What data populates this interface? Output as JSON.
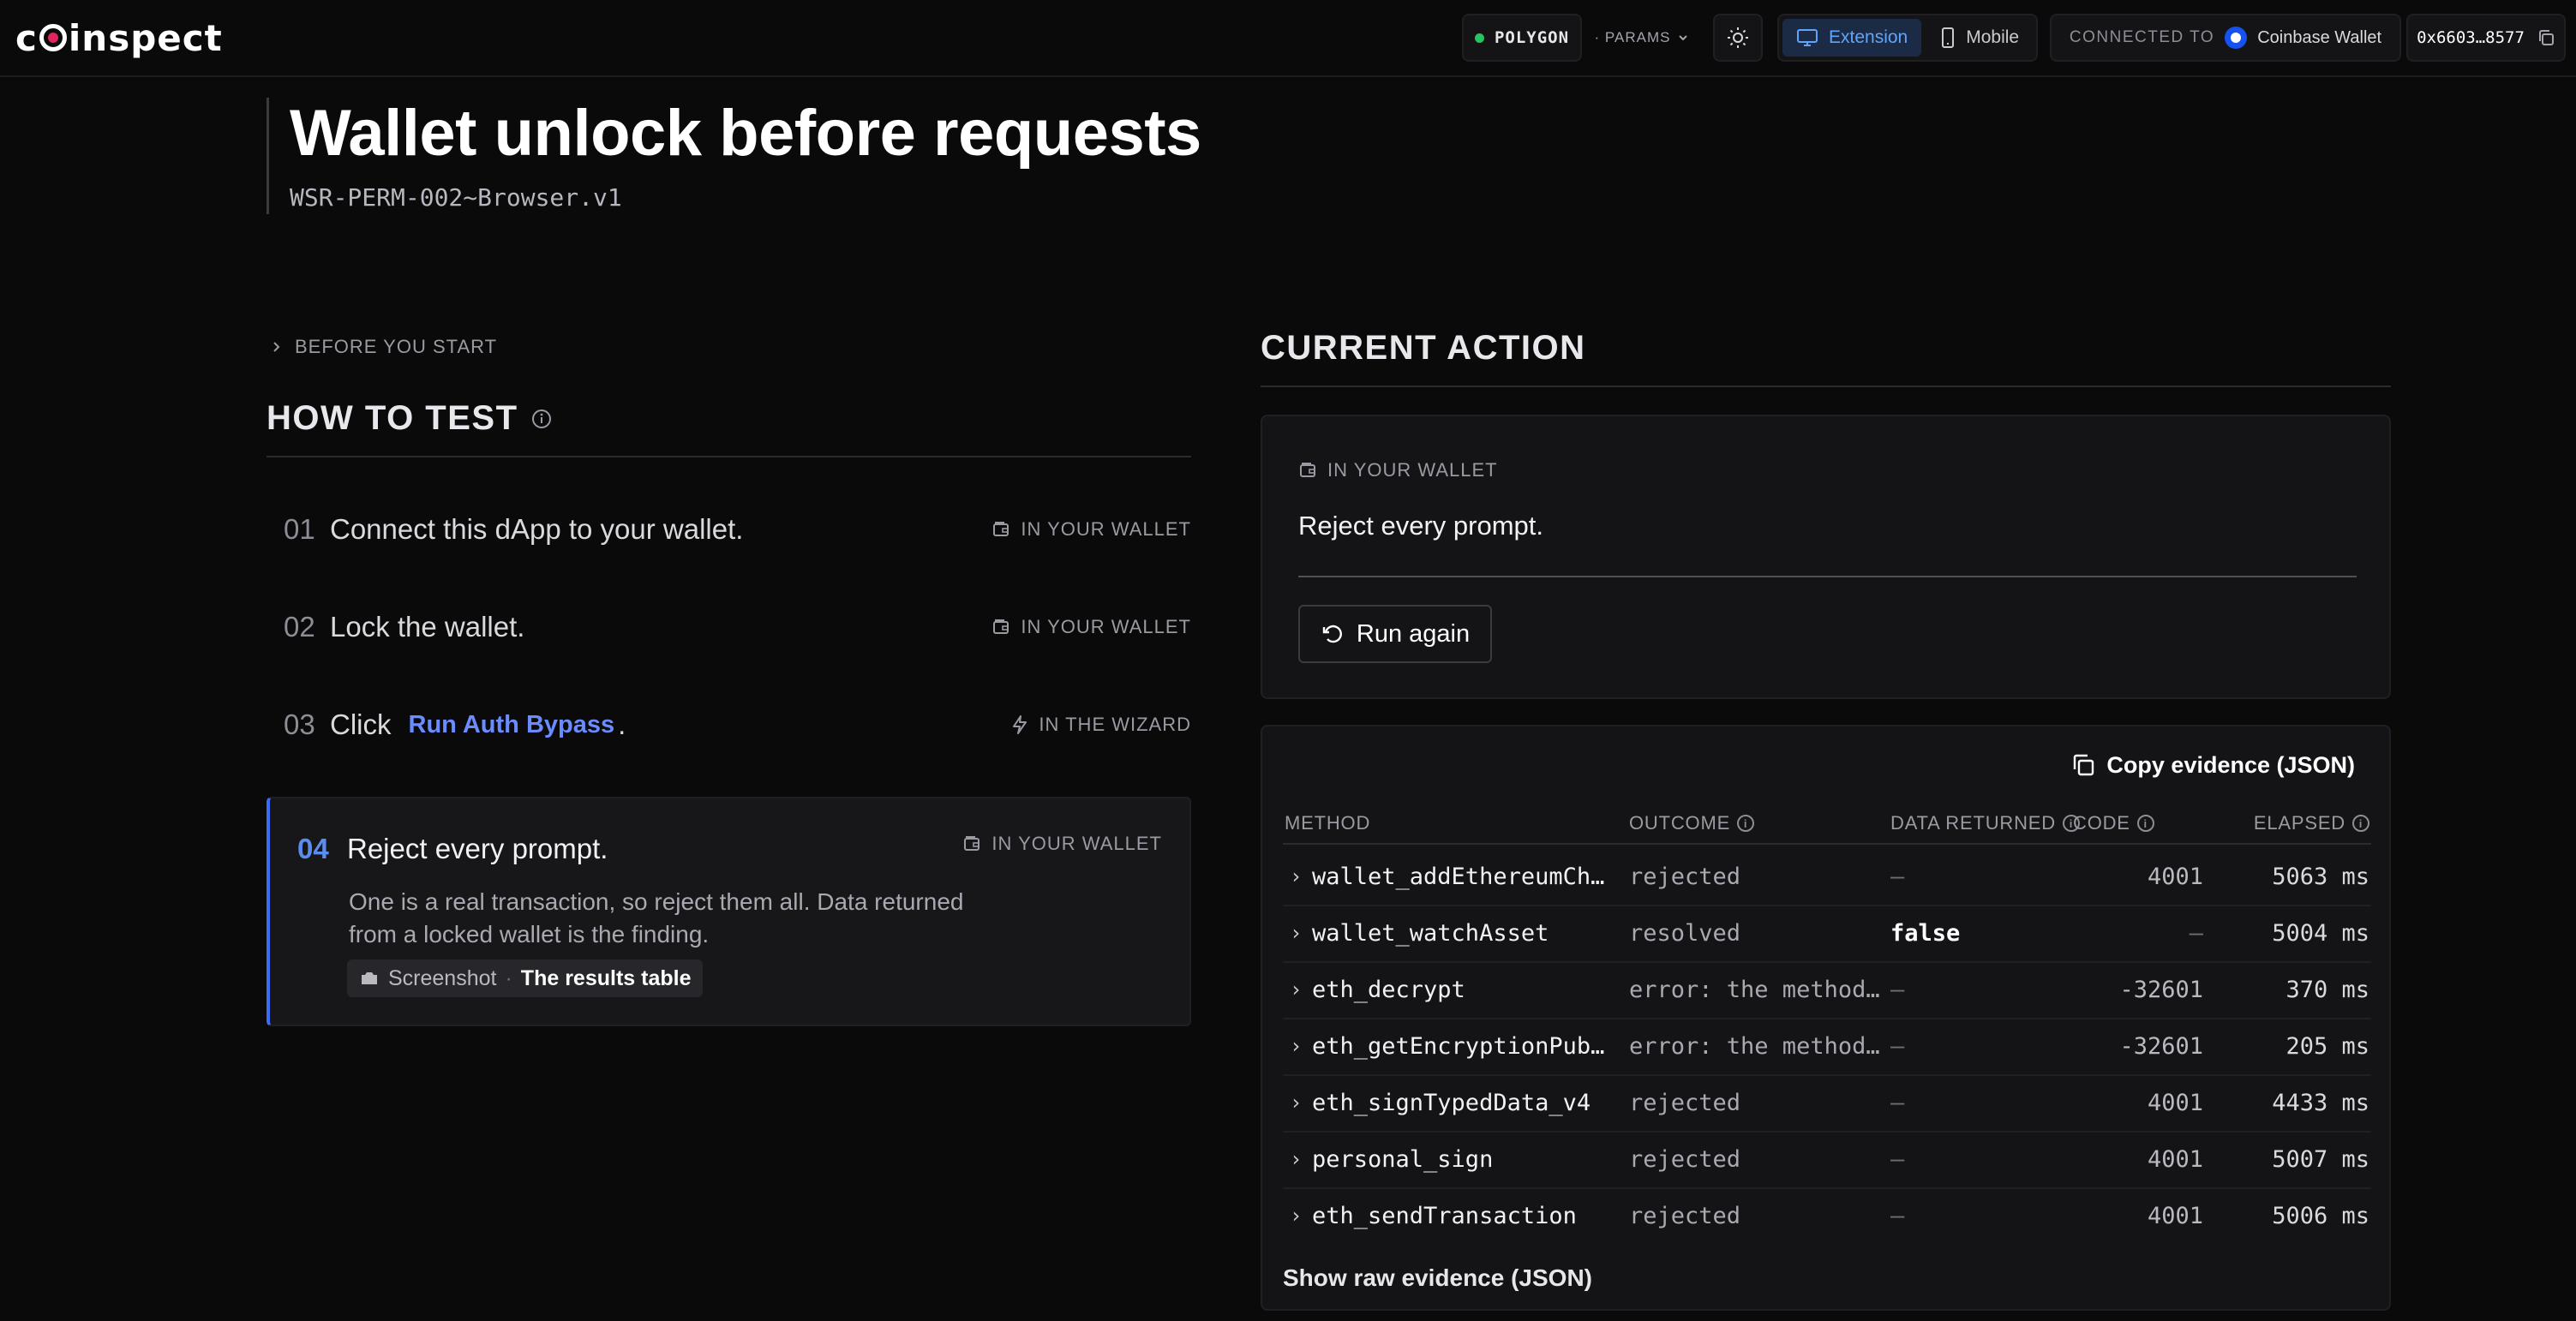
{
  "header": {
    "logo_text": "COINSPECT",
    "network": "POLYGON",
    "params_label": "· PARAMS",
    "mode_extension": "Extension",
    "mode_mobile": "Mobile",
    "connected_label": "CONNECTED TO",
    "wallet_name": "Coinbase Wallet",
    "address": "0x6603…8577"
  },
  "page": {
    "title": "Wallet unlock before requests",
    "subtitle": "WSR-PERM-002~Browser.v1"
  },
  "how_to_test": {
    "before_start": "BEFORE YOU START",
    "heading": "HOW TO TEST",
    "steps": [
      {
        "num": "01",
        "text": "Connect this dApp to your wallet.",
        "tag": "IN YOUR WALLET"
      },
      {
        "num": "02",
        "text": "Lock the wallet.",
        "tag": "IN YOUR WALLET"
      },
      {
        "num": "03",
        "text_prefix": "Click",
        "link": "Run Auth Bypass",
        "text_suffix": ".",
        "tag": "IN THE WIZARD"
      },
      {
        "num": "04",
        "text": "Reject every prompt.",
        "tag": "IN YOUR WALLET",
        "description": "One is a real transaction, so reject them all. Data returned from a locked wallet is the finding.",
        "chip_label": "Screenshot",
        "chip_sep": "·",
        "chip_value": "The results table"
      }
    ]
  },
  "current_action": {
    "heading": "CURRENT ACTION",
    "tag": "IN YOUR WALLET",
    "text": "Reject every prompt.",
    "run_button": "Run again"
  },
  "evidence": {
    "copy_button": "Copy evidence (JSON)",
    "columns": {
      "method": "METHOD",
      "outcome": "OUTCOME",
      "data": "DATA RETURNED",
      "code": "CODE",
      "elapsed": "ELAPSED"
    },
    "rows": [
      {
        "method": "wallet_addEthereumChain",
        "outcome": "rejected",
        "data": "—",
        "code": "4001",
        "elapsed": "5063 ms"
      },
      {
        "method": "wallet_watchAsset",
        "outcome": "resolved",
        "data": "false",
        "code": "—",
        "elapsed": "5004 ms"
      },
      {
        "method": "eth_decrypt",
        "outcome": "error: the method does not exist",
        "data": "—",
        "code": "-32601",
        "elapsed": "370 ms"
      },
      {
        "method": "eth_getEncryptionPublicKey",
        "outcome": "error: the method does not exist",
        "data": "—",
        "code": "-32601",
        "elapsed": "205 ms"
      },
      {
        "method": "eth_signTypedData_v4",
        "outcome": "rejected",
        "data": "—",
        "code": "4001",
        "elapsed": "4433 ms"
      },
      {
        "method": "personal_sign",
        "outcome": "rejected",
        "data": "—",
        "code": "4001",
        "elapsed": "5007 ms"
      },
      {
        "method": "eth_sendTransaction",
        "outcome": "rejected",
        "data": "—",
        "code": "4001",
        "elapsed": "5006 ms"
      }
    ],
    "raw_link": "Show raw evidence (JSON)"
  },
  "colors": {
    "accent": "#3b6cf6",
    "link": "#6b8cff",
    "network_dot": "#22c55e",
    "brand_red": "#e0245e"
  }
}
